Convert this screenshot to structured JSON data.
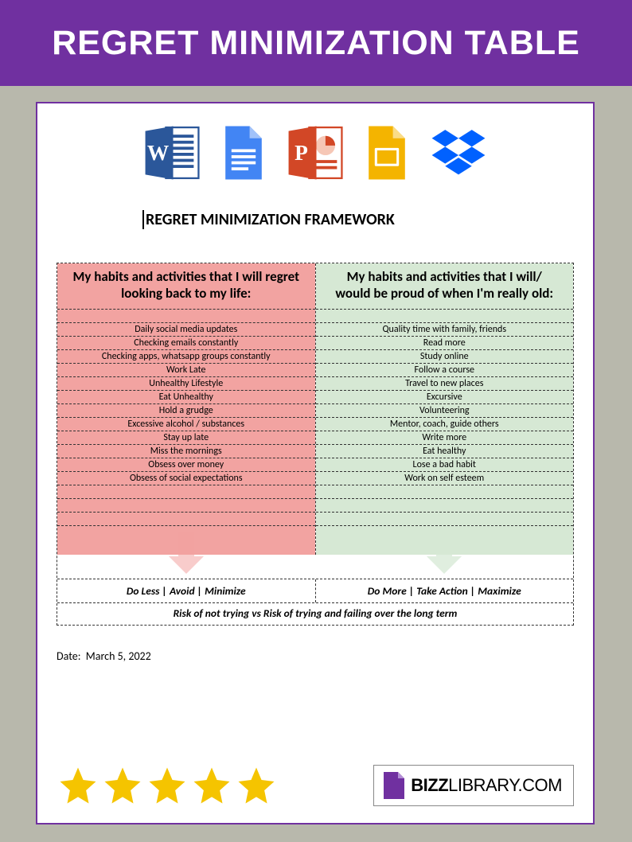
{
  "header": {
    "title": "REGRET MINIMIZATION TABLE"
  },
  "doc": {
    "title": "REGRET MINIMIZATION FRAMEWORK",
    "date_label": "Date:",
    "date_value": "March 5, 2022"
  },
  "regret_col": {
    "header": "My habits and activities that I will regret looking back to my life:",
    "items": [
      "Daily social media updates",
      "Checking emails constantly",
      "Checking apps, whatsapp groups constantly",
      "Work Late",
      "Unhealthy Lifestyle",
      "Eat Unhealthy",
      "Hold a grudge",
      "Excessive alcohol / substances",
      "Stay up late",
      "Miss the mornings",
      "Obsess over money",
      "Obsess of social expectations"
    ],
    "actions": "Do Less     |   Avoid   |   Minimize"
  },
  "proud_col": {
    "header": "My habits and activities that I will/ would be proud of when I'm really old:",
    "items": [
      "Quality time with family, friends",
      "Read more",
      "Study online",
      "Follow a course",
      "Travel to new places",
      "Excursive",
      "Volunteering",
      "Mentor, coach, guide others",
      "Write more",
      "Eat healthy",
      "Lose a bad habit",
      "Work on self esteem"
    ],
    "actions": "Do More     |   Take Action   |   Maximize"
  },
  "risk_line": "Risk of not trying vs Risk of trying and failing over the long term",
  "brand": {
    "bold": "BIZZ",
    "rest": "LIBRARY.COM"
  },
  "icons": [
    "word-icon",
    "gdocs-icon",
    "powerpoint-icon",
    "gslides-icon",
    "dropbox-icon"
  ]
}
